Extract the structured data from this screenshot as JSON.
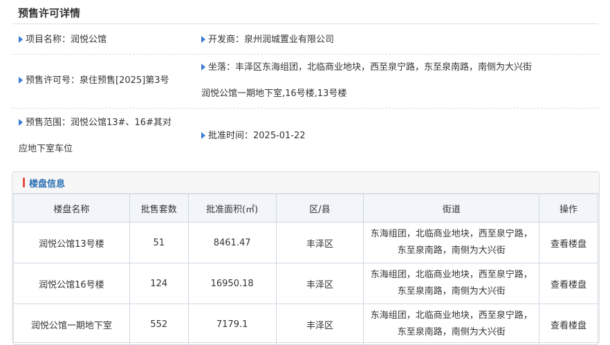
{
  "page": {
    "title": "预售许可详情"
  },
  "info": {
    "project_name": "项目名称：润悦公馆",
    "developer": "开发商：泉州润城置业有限公司",
    "permit_no": "预售许可号：泉住预售[2025]第3号",
    "location_line1": "坐落：丰泽区东海组团，北临商业地块，西至泉宁路，东至泉南路，南侧为大兴街",
    "location_line2": "润悦公馆一期地下室,16号楼,13号楼",
    "scope_line1": "预售范围：润悦公馆13#、16#其对",
    "scope_line2": "应地下室车位",
    "approval_time": "批准时间：2025-01-22"
  },
  "panel": {
    "title": "楼盘信息"
  },
  "table": {
    "headers": [
      "楼盘名称",
      "批售套数",
      "批准面积(㎡)",
      "区/县",
      "街道",
      "操作"
    ],
    "rows": [
      {
        "name": "润悦公馆13号楼",
        "units": "51",
        "area": "8461.47",
        "district": "丰泽区",
        "street1": "东海组团，北临商业地块，西至泉宁路，",
        "street2": "东至泉南路，南侧为大兴街",
        "action": "查看楼盘"
      },
      {
        "name": "润悦公馆16号楼",
        "units": "124",
        "area": "16950.18",
        "district": "丰泽区",
        "street1": "东海组团，北临商业地块，西至泉宁路，",
        "street2": "东至泉南路，南侧为大兴街",
        "action": "查看楼盘"
      },
      {
        "name": "润悦公馆一期地下室",
        "units": "552",
        "area": "7179.1",
        "district": "丰泽区",
        "street1": "东海组团，北临商业地块，西至泉宁路，",
        "street2": "东至泉南路，南侧为大兴街",
        "action": "查看楼盘"
      }
    ]
  },
  "colors": {
    "accent": "#2c6fb4",
    "marker": "#3a7bd5",
    "bar": "#e74c3c"
  }
}
